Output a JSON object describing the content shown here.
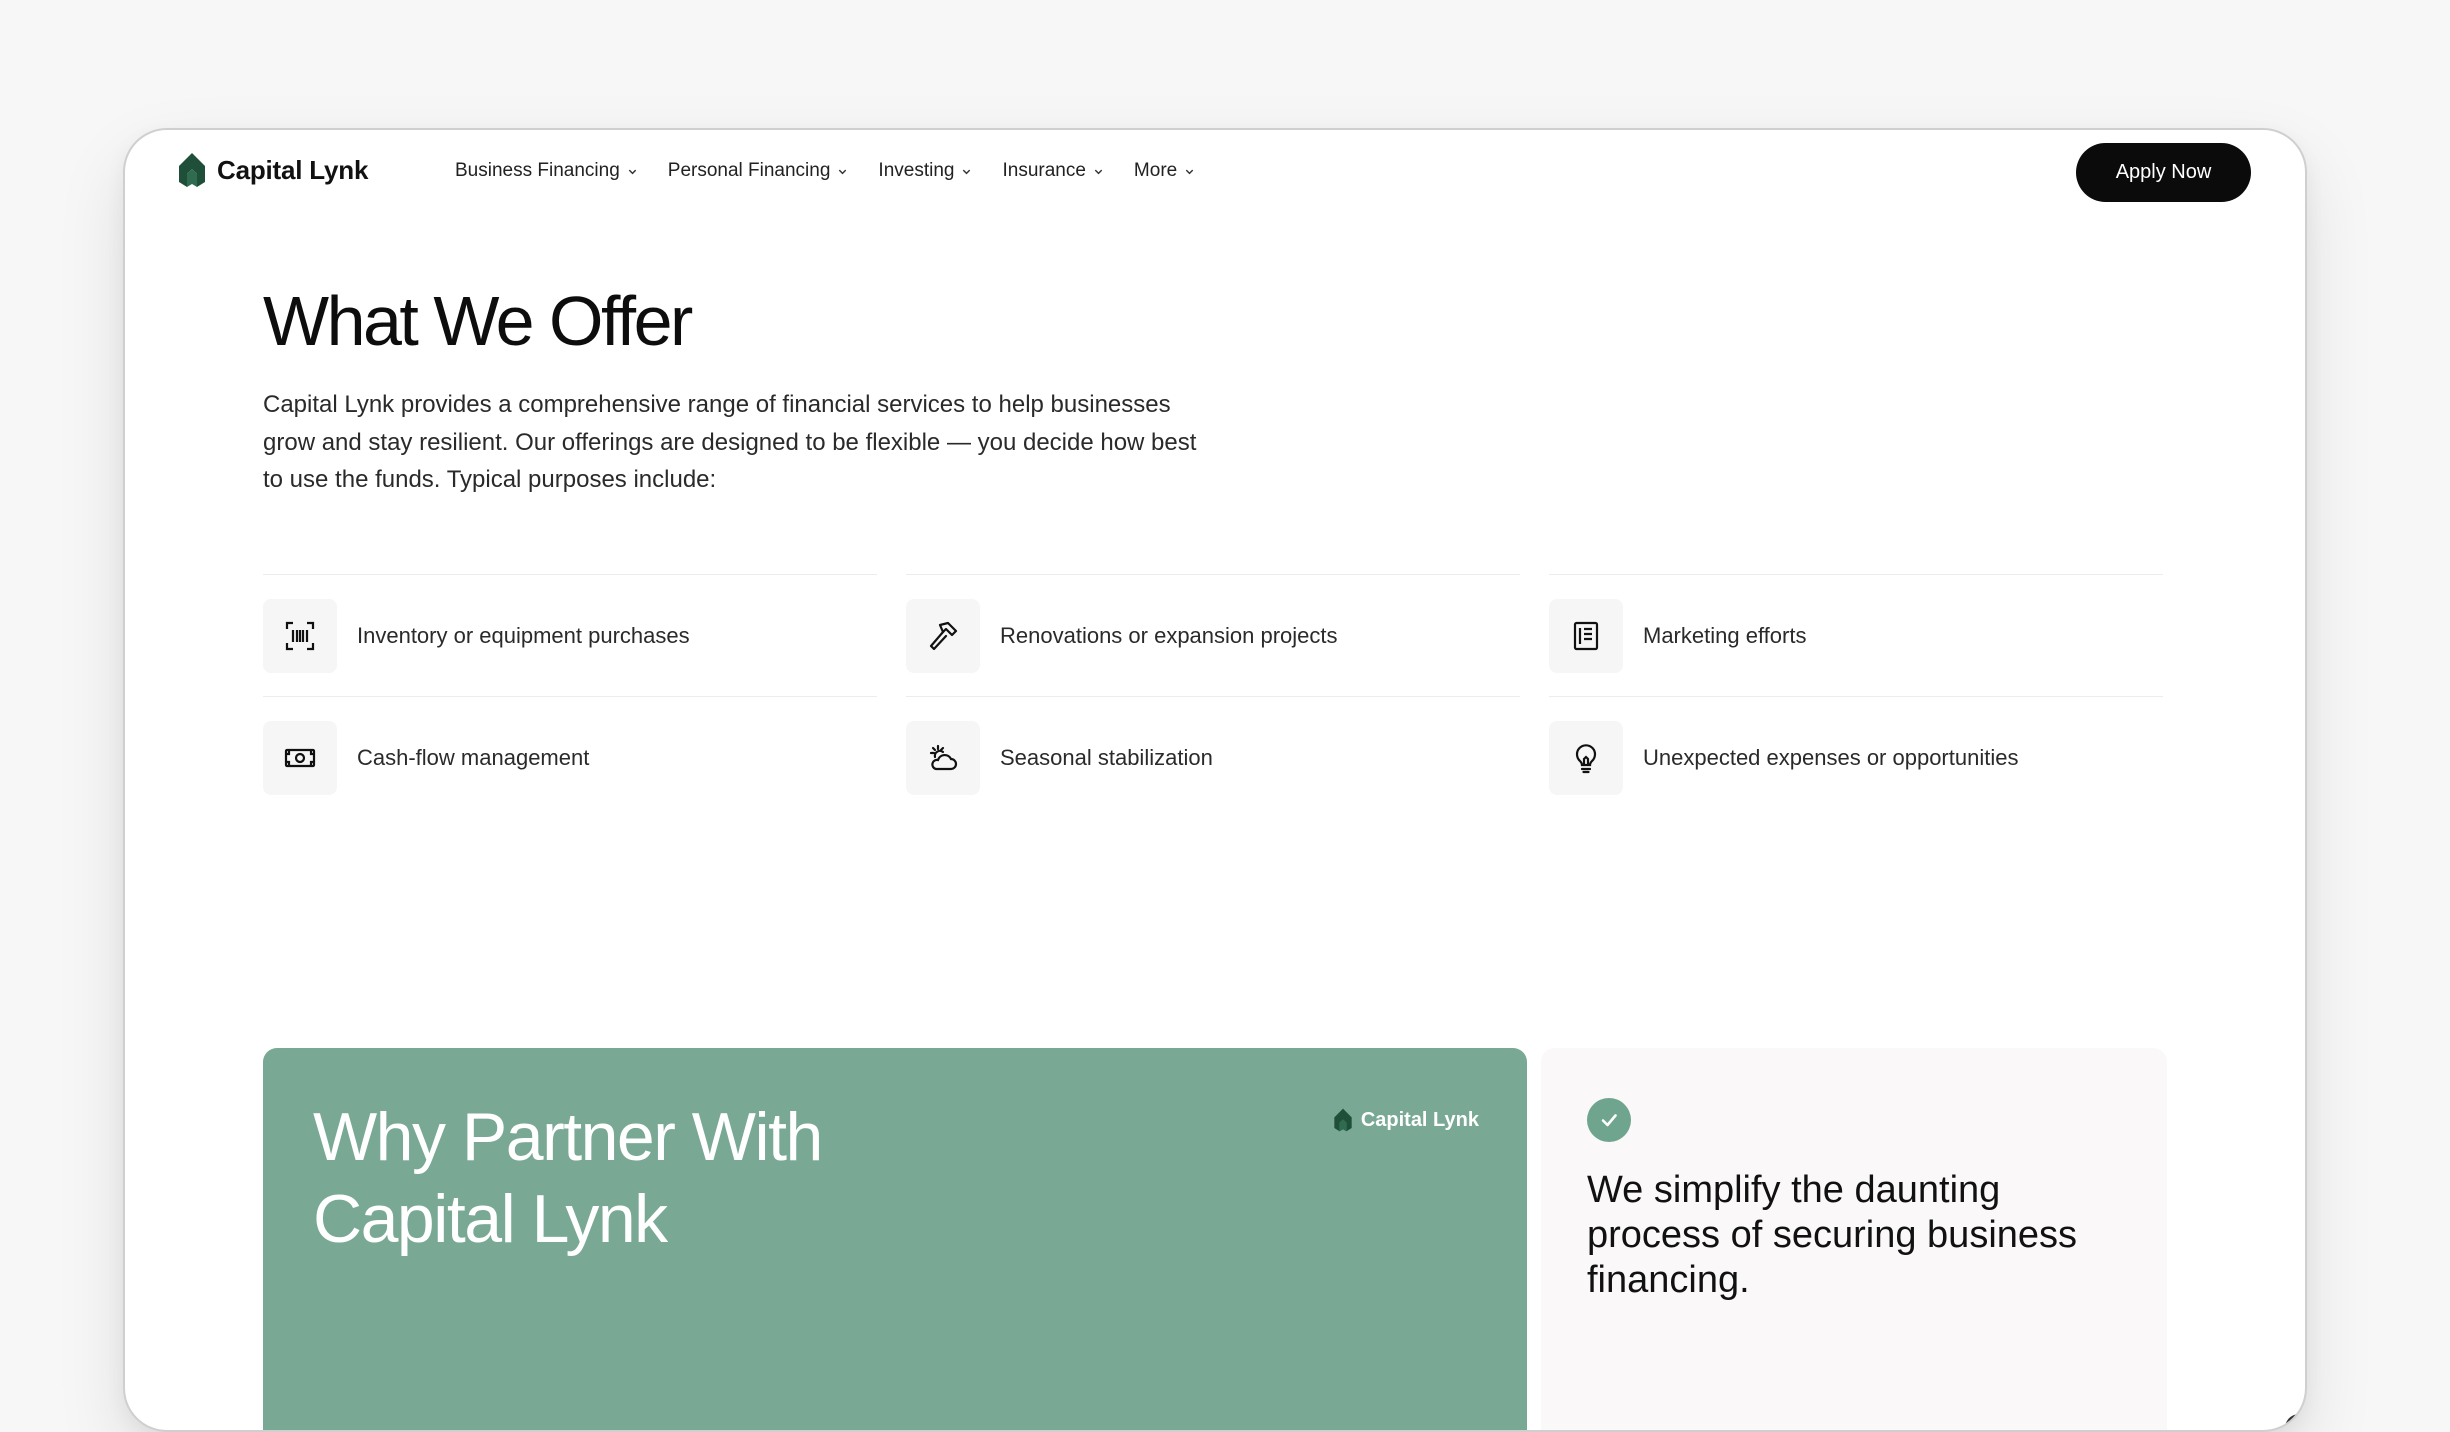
{
  "brand": {
    "name": "Capital Lynk",
    "color": "#1f4f38"
  },
  "nav": {
    "items": [
      {
        "label": "Business Financing"
      },
      {
        "label": "Personal Financing"
      },
      {
        "label": "Investing"
      },
      {
        "label": "Insurance"
      },
      {
        "label": "More"
      }
    ],
    "cta_label": "Apply Now"
  },
  "offer": {
    "title": "What We Offer",
    "description": "Capital Lynk provides a comprehensive range of financial services to help businesses grow and stay resilient. Our offerings are designed to be flexible — you decide how best to use the funds. Typical purposes include:",
    "items": [
      {
        "label": "Inventory or equipment purchases",
        "icon": "barcode-scan-icon"
      },
      {
        "label": "Renovations or expansion projects",
        "icon": "hammer-icon"
      },
      {
        "label": "Marketing efforts",
        "icon": "newspaper-icon"
      },
      {
        "label": "Cash-flow management",
        "icon": "banknote-icon"
      },
      {
        "label": "Seasonal stabilization",
        "icon": "sun-cloud-icon"
      },
      {
        "label": "Unexpected expenses or opportunities",
        "icon": "lightbulb-icon"
      }
    ]
  },
  "partner": {
    "title_line1": "Why Partner With",
    "title_line2": "Capital Lynk",
    "logo_text": "Capital Lynk",
    "card_color": "#79a994"
  },
  "benefit": {
    "icon": "check-circle-icon",
    "text": "We simplify the daunting process of securing business financing."
  }
}
